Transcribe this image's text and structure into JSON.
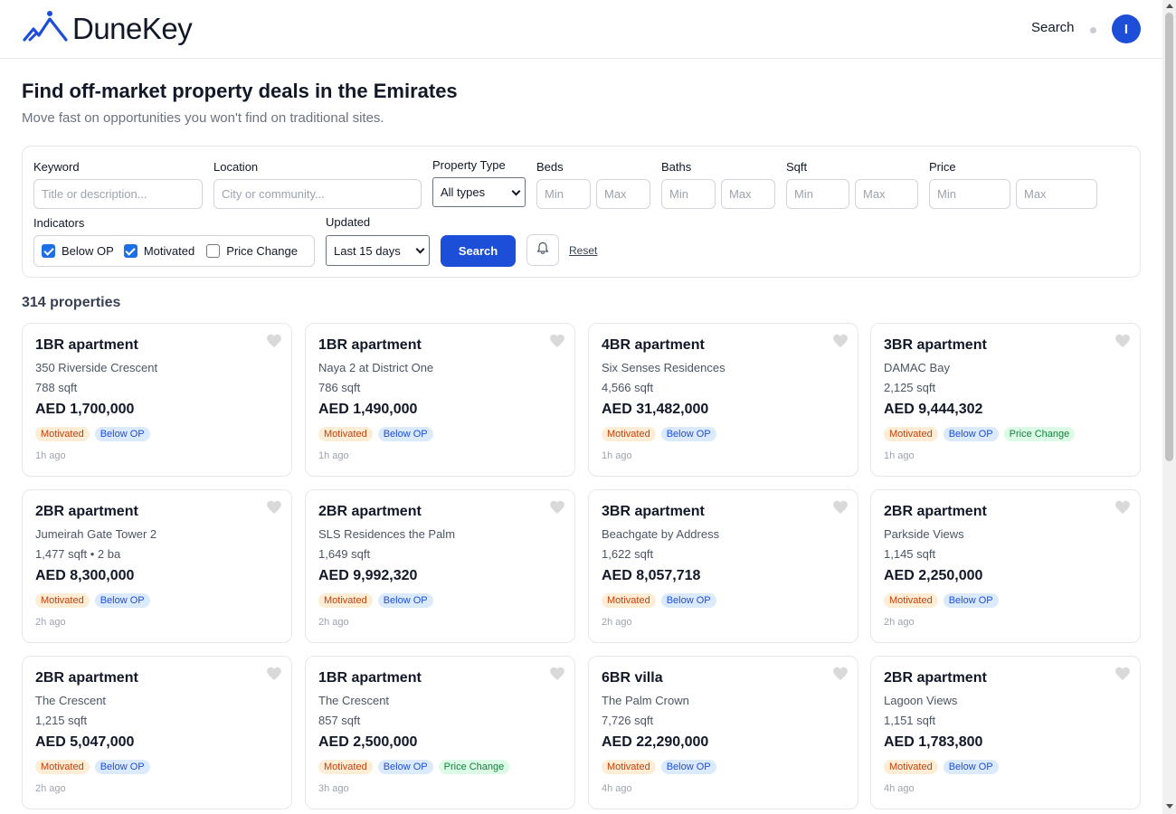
{
  "header": {
    "brand": "DuneKey",
    "nav_search": "Search",
    "avatar_initial": "I",
    "brand_color": "#1d4ed8"
  },
  "hero": {
    "title": "Find off-market property deals in the Emirates",
    "subtitle": "Move fast on opportunities you won't find on traditional sites."
  },
  "filters": {
    "keyword_label": "Keyword",
    "keyword_placeholder": "Title or description...",
    "location_label": "Location",
    "location_placeholder": "City or community...",
    "type_label": "Property Type",
    "type_value": "All types",
    "beds_label": "Beds",
    "baths_label": "Baths",
    "sqft_label": "Sqft",
    "price_label": "Price",
    "min_placeholder": "Min",
    "max_placeholder": "Max",
    "indicators_label": "Indicators",
    "indicators": [
      {
        "label": "Below OP",
        "checked": true
      },
      {
        "label": "Motivated",
        "checked": true
      },
      {
        "label": "Price Change",
        "checked": false
      }
    ],
    "updated_label": "Updated",
    "updated_value": "Last 15 days",
    "search_button": "Search",
    "reset_link": "Reset"
  },
  "results": {
    "count_text": "314 properties",
    "cards": [
      {
        "title": "1BR apartment",
        "location": "350 Riverside Crescent",
        "size": "788 sqft",
        "price": "AED 1,700,000",
        "tags": [
          "Motivated",
          "Below OP"
        ],
        "time": "1h ago"
      },
      {
        "title": "1BR apartment",
        "location": "Naya 2 at District One",
        "size": "786 sqft",
        "price": "AED 1,490,000",
        "tags": [
          "Motivated",
          "Below OP"
        ],
        "time": "1h ago"
      },
      {
        "title": "4BR apartment",
        "location": "Six Senses Residences",
        "size": "4,566 sqft",
        "price": "AED 31,482,000",
        "tags": [
          "Motivated",
          "Below OP"
        ],
        "time": "1h ago"
      },
      {
        "title": "3BR apartment",
        "location": "DAMAC Bay",
        "size": "2,125 sqft",
        "price": "AED 9,444,302",
        "tags": [
          "Motivated",
          "Below OP",
          "Price Change"
        ],
        "time": "1h ago"
      },
      {
        "title": "2BR apartment",
        "location": "Jumeirah Gate Tower 2",
        "size": "1,477 sqft • 2 ba",
        "price": "AED 8,300,000",
        "tags": [
          "Motivated",
          "Below OP"
        ],
        "time": "2h ago"
      },
      {
        "title": "2BR apartment",
        "location": "SLS Residences the Palm",
        "size": "1,649 sqft",
        "price": "AED 9,992,320",
        "tags": [
          "Motivated",
          "Below OP"
        ],
        "time": "2h ago"
      },
      {
        "title": "3BR apartment",
        "location": "Beachgate by Address",
        "size": "1,622 sqft",
        "price": "AED 8,057,718",
        "tags": [
          "Motivated",
          "Below OP"
        ],
        "time": "2h ago"
      },
      {
        "title": "2BR apartment",
        "location": "Parkside Views",
        "size": "1,145 sqft",
        "price": "AED 2,250,000",
        "tags": [
          "Motivated",
          "Below OP"
        ],
        "time": "2h ago"
      },
      {
        "title": "2BR apartment",
        "location": "The Crescent",
        "size": "1,215 sqft",
        "price": "AED 5,047,000",
        "tags": [
          "Motivated",
          "Below OP"
        ],
        "time": "2h ago"
      },
      {
        "title": "1BR apartment",
        "location": "The Crescent",
        "size": "857 sqft",
        "price": "AED 2,500,000",
        "tags": [
          "Motivated",
          "Below OP",
          "Price Change"
        ],
        "time": "3h ago"
      },
      {
        "title": "6BR villa",
        "location": "The Palm Crown",
        "size": "7,726 sqft",
        "price": "AED 22,290,000",
        "tags": [
          "Motivated",
          "Below OP"
        ],
        "time": "4h ago"
      },
      {
        "title": "2BR apartment",
        "location": "Lagoon Views",
        "size": "1,151 sqft",
        "price": "AED 1,783,800",
        "tags": [
          "Motivated",
          "Below OP"
        ],
        "time": "4h ago"
      }
    ]
  }
}
